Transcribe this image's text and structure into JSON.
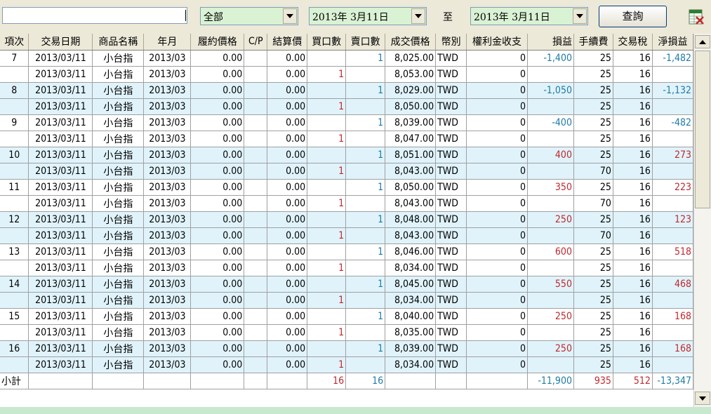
{
  "toolbar": {
    "search_value": "",
    "category_select": "全部",
    "date_from": "2013年 3月11日",
    "to_label": "至",
    "date_to": "2013年 3月11日",
    "query_button": "查詢",
    "export_icon": "excel-export-icon"
  },
  "columns": [
    "項次",
    "交易日期",
    "商品名稱",
    "年月",
    "履約價格",
    "C/P",
    "結算價",
    "買口數",
    "賣口數",
    "成交價格",
    "幣別",
    "權利金收支",
    "損益",
    "手續費",
    "交易稅",
    "淨損益"
  ],
  "rows": [
    {
      "item": "7",
      "date": "2013/03/11",
      "product": "小台指",
      "ym": "2013/03",
      "strike": "0.00",
      "cp": "",
      "settle": "0.00",
      "buy": "",
      "sell": "1",
      "price": "8,025.00",
      "cur": "TWD",
      "premium": "0",
      "pl": "-1,400",
      "fee": "25",
      "tax": "16",
      "net": "-1,482"
    },
    {
      "item": "",
      "date": "2013/03/11",
      "product": "小台指",
      "ym": "2013/03",
      "strike": "0.00",
      "cp": "",
      "settle": "0.00",
      "buy": "1",
      "sell": "",
      "price": "8,053.00",
      "cur": "TWD",
      "premium": "0",
      "pl": "",
      "fee": "25",
      "tax": "16",
      "net": ""
    },
    {
      "item": "8",
      "date": "2013/03/11",
      "product": "小台指",
      "ym": "2013/03",
      "strike": "0.00",
      "cp": "",
      "settle": "0.00",
      "buy": "",
      "sell": "1",
      "price": "8,029.00",
      "cur": "TWD",
      "premium": "0",
      "pl": "-1,050",
      "fee": "25",
      "tax": "16",
      "net": "-1,132"
    },
    {
      "item": "",
      "date": "2013/03/11",
      "product": "小台指",
      "ym": "2013/03",
      "strike": "0.00",
      "cp": "",
      "settle": "0.00",
      "buy": "1",
      "sell": "",
      "price": "8,050.00",
      "cur": "TWD",
      "premium": "0",
      "pl": "",
      "fee": "25",
      "tax": "16",
      "net": ""
    },
    {
      "item": "9",
      "date": "2013/03/11",
      "product": "小台指",
      "ym": "2013/03",
      "strike": "0.00",
      "cp": "",
      "settle": "0.00",
      "buy": "",
      "sell": "1",
      "price": "8,039.00",
      "cur": "TWD",
      "premium": "0",
      "pl": "-400",
      "fee": "25",
      "tax": "16",
      "net": "-482"
    },
    {
      "item": "",
      "date": "2013/03/11",
      "product": "小台指",
      "ym": "2013/03",
      "strike": "0.00",
      "cp": "",
      "settle": "0.00",
      "buy": "1",
      "sell": "",
      "price": "8,047.00",
      "cur": "TWD",
      "premium": "0",
      "pl": "",
      "fee": "25",
      "tax": "16",
      "net": ""
    },
    {
      "item": "10",
      "date": "2013/03/11",
      "product": "小台指",
      "ym": "2013/03",
      "strike": "0.00",
      "cp": "",
      "settle": "0.00",
      "buy": "",
      "sell": "1",
      "price": "8,051.00",
      "cur": "TWD",
      "premium": "0",
      "pl": "400",
      "fee": "25",
      "tax": "16",
      "net": "273"
    },
    {
      "item": "",
      "date": "2013/03/11",
      "product": "小台指",
      "ym": "2013/03",
      "strike": "0.00",
      "cp": "",
      "settle": "0.00",
      "buy": "1",
      "sell": "",
      "price": "8,043.00",
      "cur": "TWD",
      "premium": "0",
      "pl": "",
      "fee": "70",
      "tax": "16",
      "net": ""
    },
    {
      "item": "11",
      "date": "2013/03/11",
      "product": "小台指",
      "ym": "2013/03",
      "strike": "0.00",
      "cp": "",
      "settle": "0.00",
      "buy": "",
      "sell": "1",
      "price": "8,050.00",
      "cur": "TWD",
      "premium": "0",
      "pl": "350",
      "fee": "25",
      "tax": "16",
      "net": "223"
    },
    {
      "item": "",
      "date": "2013/03/11",
      "product": "小台指",
      "ym": "2013/03",
      "strike": "0.00",
      "cp": "",
      "settle": "0.00",
      "buy": "1",
      "sell": "",
      "price": "8,043.00",
      "cur": "TWD",
      "premium": "0",
      "pl": "",
      "fee": "70",
      "tax": "16",
      "net": ""
    },
    {
      "item": "12",
      "date": "2013/03/11",
      "product": "小台指",
      "ym": "2013/03",
      "strike": "0.00",
      "cp": "",
      "settle": "0.00",
      "buy": "",
      "sell": "1",
      "price": "8,048.00",
      "cur": "TWD",
      "premium": "0",
      "pl": "250",
      "fee": "25",
      "tax": "16",
      "net": "123"
    },
    {
      "item": "",
      "date": "2013/03/11",
      "product": "小台指",
      "ym": "2013/03",
      "strike": "0.00",
      "cp": "",
      "settle": "0.00",
      "buy": "1",
      "sell": "",
      "price": "8,043.00",
      "cur": "TWD",
      "premium": "0",
      "pl": "",
      "fee": "70",
      "tax": "16",
      "net": ""
    },
    {
      "item": "13",
      "date": "2013/03/11",
      "product": "小台指",
      "ym": "2013/03",
      "strike": "0.00",
      "cp": "",
      "settle": "0.00",
      "buy": "",
      "sell": "1",
      "price": "8,046.00",
      "cur": "TWD",
      "premium": "0",
      "pl": "600",
      "fee": "25",
      "tax": "16",
      "net": "518"
    },
    {
      "item": "",
      "date": "2013/03/11",
      "product": "小台指",
      "ym": "2013/03",
      "strike": "0.00",
      "cp": "",
      "settle": "0.00",
      "buy": "1",
      "sell": "",
      "price": "8,034.00",
      "cur": "TWD",
      "premium": "0",
      "pl": "",
      "fee": "25",
      "tax": "16",
      "net": ""
    },
    {
      "item": "14",
      "date": "2013/03/11",
      "product": "小台指",
      "ym": "2013/03",
      "strike": "0.00",
      "cp": "",
      "settle": "0.00",
      "buy": "",
      "sell": "1",
      "price": "8,045.00",
      "cur": "TWD",
      "premium": "0",
      "pl": "550",
      "fee": "25",
      "tax": "16",
      "net": "468"
    },
    {
      "item": "",
      "date": "2013/03/11",
      "product": "小台指",
      "ym": "2013/03",
      "strike": "0.00",
      "cp": "",
      "settle": "0.00",
      "buy": "1",
      "sell": "",
      "price": "8,034.00",
      "cur": "TWD",
      "premium": "0",
      "pl": "",
      "fee": "25",
      "tax": "16",
      "net": ""
    },
    {
      "item": "15",
      "date": "2013/03/11",
      "product": "小台指",
      "ym": "2013/03",
      "strike": "0.00",
      "cp": "",
      "settle": "0.00",
      "buy": "",
      "sell": "1",
      "price": "8,040.00",
      "cur": "TWD",
      "premium": "0",
      "pl": "250",
      "fee": "25",
      "tax": "16",
      "net": "168"
    },
    {
      "item": "",
      "date": "2013/03/11",
      "product": "小台指",
      "ym": "2013/03",
      "strike": "0.00",
      "cp": "",
      "settle": "0.00",
      "buy": "1",
      "sell": "",
      "price": "8,035.00",
      "cur": "TWD",
      "premium": "0",
      "pl": "",
      "fee": "25",
      "tax": "16",
      "net": ""
    },
    {
      "item": "16",
      "date": "2013/03/11",
      "product": "小台指",
      "ym": "2013/03",
      "strike": "0.00",
      "cp": "",
      "settle": "0.00",
      "buy": "",
      "sell": "1",
      "price": "8,039.00",
      "cur": "TWD",
      "premium": "0",
      "pl": "250",
      "fee": "25",
      "tax": "16",
      "net": "168"
    },
    {
      "item": "",
      "date": "2013/03/11",
      "product": "小台指",
      "ym": "2013/03",
      "strike": "0.00",
      "cp": "",
      "settle": "0.00",
      "buy": "1",
      "sell": "",
      "price": "8,034.00",
      "cur": "TWD",
      "premium": "0",
      "pl": "",
      "fee": "25",
      "tax": "16",
      "net": ""
    }
  ],
  "subtotal": {
    "label": "小計",
    "buy": "16",
    "sell": "16",
    "pl": "-11,900",
    "fee": "935",
    "tax": "512",
    "net": "-13,347"
  },
  "colors": {
    "row_alt": "#e0f3fb",
    "positive_red": "#c0282d",
    "negative_blue": "#1e7aa8",
    "combo_green": "#d9f2d4"
  }
}
